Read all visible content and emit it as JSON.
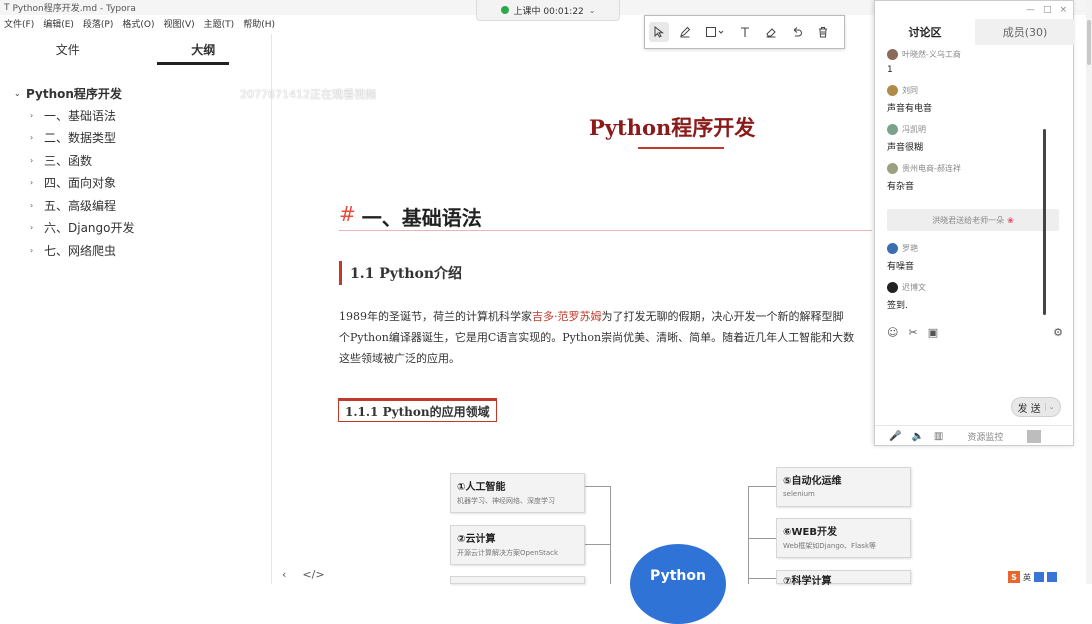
{
  "window": {
    "title": "Python程序开发.md - Typora",
    "app_icon": "T"
  },
  "menu": [
    "文件(F)",
    "编辑(E)",
    "段落(P)",
    "格式(O)",
    "视图(V)",
    "主题(T)",
    "帮助(H)"
  ],
  "sidebar": {
    "tabs": [
      "文件",
      "大纲"
    ],
    "outline_root": "Python程序开发",
    "outline_items": [
      "一、基础语法",
      "二、数据类型",
      "三、函数",
      "四、面向对象",
      "五、高级编程",
      "六、Django开发",
      "七、网络爬虫"
    ]
  },
  "watermark": "2077671412正在观看视频",
  "recording": {
    "label": "上课中 00:01:22"
  },
  "annotation_tools": [
    "select-icon",
    "pen-icon",
    "rectangle-icon",
    "text-icon",
    "eraser-icon",
    "undo-icon",
    "trash-icon"
  ],
  "document": {
    "title": "Python程序开发",
    "h1_hash": "#",
    "h1": "一、基础语法",
    "h2": "1.1 Python介绍",
    "para": [
      {
        "pre": "1989年的圣诞节，荷兰的计算机科学家",
        "hl": "吉多·范罗苏姆",
        "post": "为了打发无聊的假期，决心开发一个新的解释型脚"
      },
      "个Python编译器诞生，它是用C语言实现的。Python崇尚优美、清晰、简单。随着近几年人工智能和大数",
      "这些领域被广泛的应用。"
    ],
    "h3": "1.1.1 Python的应用领域",
    "mindmap": {
      "center": "Python",
      "nodes": [
        {
          "title": "①人工智能",
          "sub": "机器学习、神经网络、深度学习"
        },
        {
          "title": "②云计算",
          "sub": "开源云计算解决方案OpenStack"
        },
        {
          "title": "⑤自动化运维",
          "sub": "selenium"
        },
        {
          "title": "⑥WEB开发",
          "sub": "Web框架如Django、Flask等"
        },
        {
          "title": "⑦科学计算",
          "sub": ""
        }
      ]
    }
  },
  "chat": {
    "tabs": [
      "讨论区",
      "成员(30)"
    ],
    "window_controls": [
      "—",
      "□",
      "×"
    ],
    "messages": [
      {
        "user": "叶晓然-义乌工商",
        "text": "1",
        "avatar": "#8a6a5a"
      },
      {
        "user": "刘同",
        "text": "声音有电音",
        "avatar": "#b08a4a"
      },
      {
        "user": "冯凯明",
        "text": "声音很糊",
        "avatar": "#7aa38a"
      },
      {
        "user": "贵州电商-郝连祥",
        "text": "有杂音",
        "avatar": "#9aa080"
      },
      {
        "user": "罗艳",
        "text": "有噪音",
        "avatar": "#3b6db0"
      },
      {
        "user": "迟博文",
        "text": "签到.",
        "avatar": "#222222"
      }
    ],
    "gift": "洪晓君送给老师一朵",
    "gift_flower": "❀",
    "toolbar": [
      "☺",
      "✂",
      "▣",
      "⚙"
    ],
    "send_label": "发 送",
    "send_dropdown": "⌄",
    "footer_icons": [
      "🎤",
      "🔈",
      "▥"
    ],
    "footer_label": "资源监控"
  },
  "side_bottom": [
    "‹",
    "</>"
  ],
  "tray": [
    "S",
    "英"
  ]
}
